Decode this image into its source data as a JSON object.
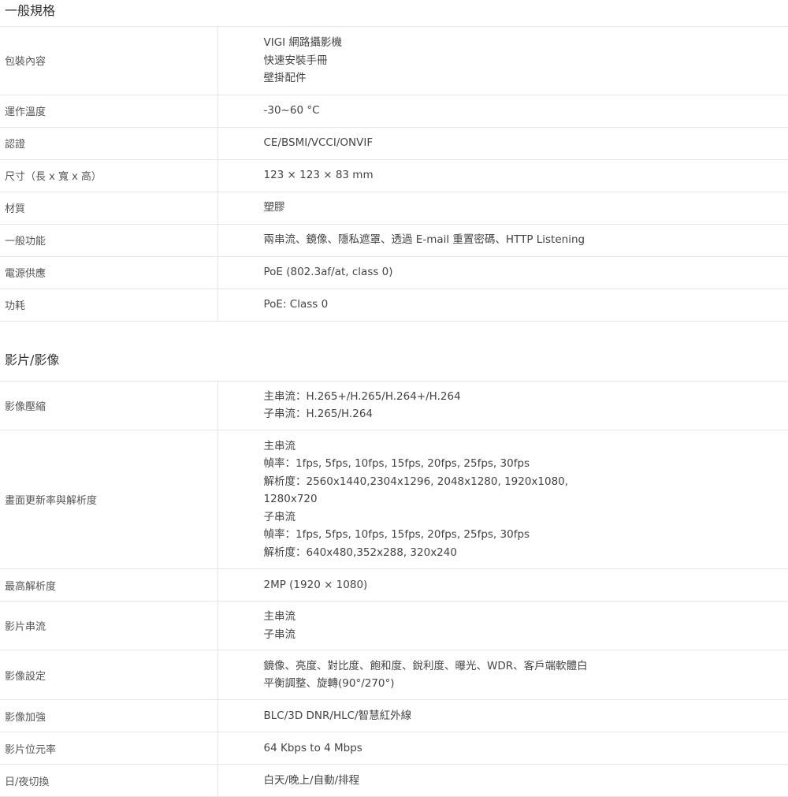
{
  "sections": [
    {
      "title": "一般規格",
      "rows": [
        {
          "label": "包裝內容",
          "lines": [
            "VIGI 網路攝影機",
            "快速安裝手冊",
            "壁掛配件"
          ]
        },
        {
          "label": "運作溫度",
          "lines": [
            "-30~60 °C"
          ]
        },
        {
          "label": "認證",
          "lines": [
            "CE/BSMI/VCCI/ONVIF"
          ]
        },
        {
          "label": "尺寸（長 x 寬 x 高）",
          "lines": [
            "123 × 123 × 83 mm"
          ]
        },
        {
          "label": "材質",
          "lines": [
            "塑膠"
          ]
        },
        {
          "label": "一般功能",
          "lines": [
            "兩串流、鏡像、隱私遮罩、透過 E-mail 重置密碼、HTTP Listening"
          ]
        },
        {
          "label": "電源供應",
          "lines": [
            "PoE (802.3af/at, class 0)"
          ]
        },
        {
          "label": "功耗",
          "lines": [
            "PoE: Class 0"
          ]
        }
      ]
    },
    {
      "title": "影片/影像",
      "rows": [
        {
          "label": "影像壓縮",
          "lines": [
            "主串流：H.265+/H.265/H.264+/H.264",
            "子串流：H.265/H.264"
          ]
        },
        {
          "label": "畫面更新率與解析度",
          "lines": [
            "主串流",
            "幀率：1fps, 5fps, 10fps, 15fps, 20fps, 25fps, 30fps",
            "解析度：2560x1440,2304x1296, 2048x1280, 1920x1080,",
            "1280x720",
            "子串流",
            "幀率：1fps, 5fps, 10fps, 15fps, 20fps, 25fps, 30fps",
            "解析度：640x480,352x288, 320x240"
          ]
        },
        {
          "label": "最高解析度",
          "lines": [
            "2MP (1920 × 1080)"
          ]
        },
        {
          "label": "影片串流",
          "lines": [
            "主串流",
            "子串流"
          ]
        },
        {
          "label": "影像設定",
          "lines": [
            "鏡像、亮度、對比度、飽和度、銳利度、曝光、WDR、客戶端軟體白",
            "平衡調整、旋轉(90°/270°)"
          ]
        },
        {
          "label": "影像加強",
          "lines": [
            "BLC/3D DNR/HLC/智慧紅外線"
          ]
        },
        {
          "label": "影片位元率",
          "lines": [
            "64 Kbps to 4 Mbps"
          ]
        },
        {
          "label": "日/夜切換",
          "lines": [
            "白天/晚上/自動/排程"
          ]
        }
      ]
    }
  ]
}
